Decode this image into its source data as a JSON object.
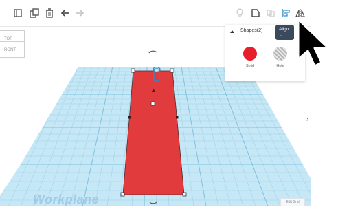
{
  "toolbar": {
    "tools": [
      {
        "name": "import-icon"
      },
      {
        "name": "duplicate-icon"
      },
      {
        "name": "trash-icon"
      },
      {
        "name": "undo-icon"
      },
      {
        "name": "redo-icon"
      }
    ],
    "right_tools": [
      {
        "name": "light-bulb-icon"
      },
      {
        "name": "group-icon"
      },
      {
        "name": "ungroup-icon"
      },
      {
        "name": "align-icon"
      },
      {
        "name": "mirror-icon"
      }
    ]
  },
  "view_cube": {
    "top_label": "TOP",
    "front_label": "RONT"
  },
  "shapes_panel": {
    "title": "Shapes(2)",
    "solid_label": "Solid",
    "hole_label": "Hole",
    "solid_color": "#e5202a"
  },
  "tooltip": {
    "title": "Align",
    "shortcut": "L"
  },
  "workplane": {
    "label": "Workplane",
    "edit_grid_label": "Edit Grid",
    "grid_color": "#bfe3f3",
    "line_color": "#8ccbe6"
  },
  "selected_shape": {
    "fill_color": "#e23b3e"
  }
}
